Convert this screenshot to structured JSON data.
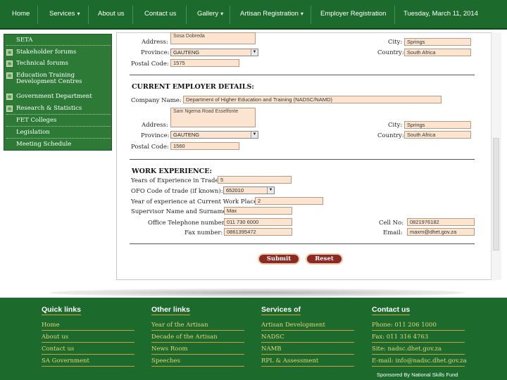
{
  "nav": {
    "home": "Home",
    "services": "Services",
    "about": "About us",
    "contact": "Contact us",
    "gallery": "Gallery",
    "artisan_registration": "Artisan Registration",
    "employer_registration": "Employer Registration",
    "date": "Tuesday, March 11, 2014"
  },
  "sidebar": {
    "items": [
      {
        "label": "SETA"
      },
      {
        "label": "Stakeholder forums"
      },
      {
        "label": "Technical forums"
      },
      {
        "label": "Education Training Development Centres"
      },
      {
        "label": "Government Department"
      },
      {
        "label": "Research & Statistics"
      },
      {
        "label": "FET Colleges"
      },
      {
        "label": "Legislation"
      },
      {
        "label": "Meeting Schedule"
      }
    ]
  },
  "form": {
    "address_label": "Address:",
    "address1_value": "Sosa Dobreda",
    "city_label": "City:",
    "city1_value": "Springs",
    "province_label": "Province:",
    "province1_value": "GAUTENG",
    "country_label": "Country:",
    "country1_value": "South Africa",
    "postal_label": "Postal Code:",
    "postal1_value": "1575",
    "employer_title": "CURRENT EMPLOYER DETAILS:",
    "company_label": "Company Name:",
    "company_value": "Department of Higher Education and Training (NADSC/NAMD)",
    "address2_value": "Sam Ngema Road Esselfonte",
    "city2_value": "Springs",
    "province2_value": "GAUTENG",
    "country2_value": "South Africa",
    "postal2_value": "1560",
    "experience_title": "WORK EXPERIENCE:",
    "years_label": "Years of Experience in Trade:",
    "years_value": "5",
    "ofo_label": "OFO Code of trade (if known):",
    "ofo_value": "652010",
    "year_current_label": "Year of experience at Current Work Place:",
    "year_current_value": "2",
    "supervisor_label": "Supervisor Name and Surname:",
    "supervisor_value": "Max",
    "office_tel_label": "Office Telephone number:",
    "office_tel_value": "011 730 6000",
    "cell_label": "Cell No:",
    "cell_value": "0821976182",
    "fax_label": "Fax number:",
    "fax_value": "0861395472",
    "email_label": "Email:",
    "email_value": "maxm@dhet.gov.za",
    "submit": "Submit",
    "reset": "Reset"
  },
  "footer": {
    "quick_title": "Quick links",
    "quick": [
      "Home",
      "About us",
      "Contact us",
      "SA Government"
    ],
    "other_title": "Other links",
    "other": [
      "Year of the Artisan",
      "Decade of the Artisan",
      "News Room",
      "Speeches"
    ],
    "services_title": "Services of",
    "services": [
      "Artisan Development",
      "NADSC",
      "NAMB",
      "RPL & Assessment"
    ],
    "contact_title": "Contact us",
    "contact": [
      "Phone: 011 206 1000",
      "Fax: 011 316 4763",
      "Site: nadsc.dhet.gov.za",
      "E-mail: info@nadsc.dhet.gov.za"
    ],
    "sponsor": "Sponsored By National Skills Fund"
  },
  "colors": {
    "brand_green": "#1d6b2c",
    "field_bg": "#fbe5d1",
    "button_red": "#8b2a22",
    "footer_link": "#e8d27a"
  }
}
